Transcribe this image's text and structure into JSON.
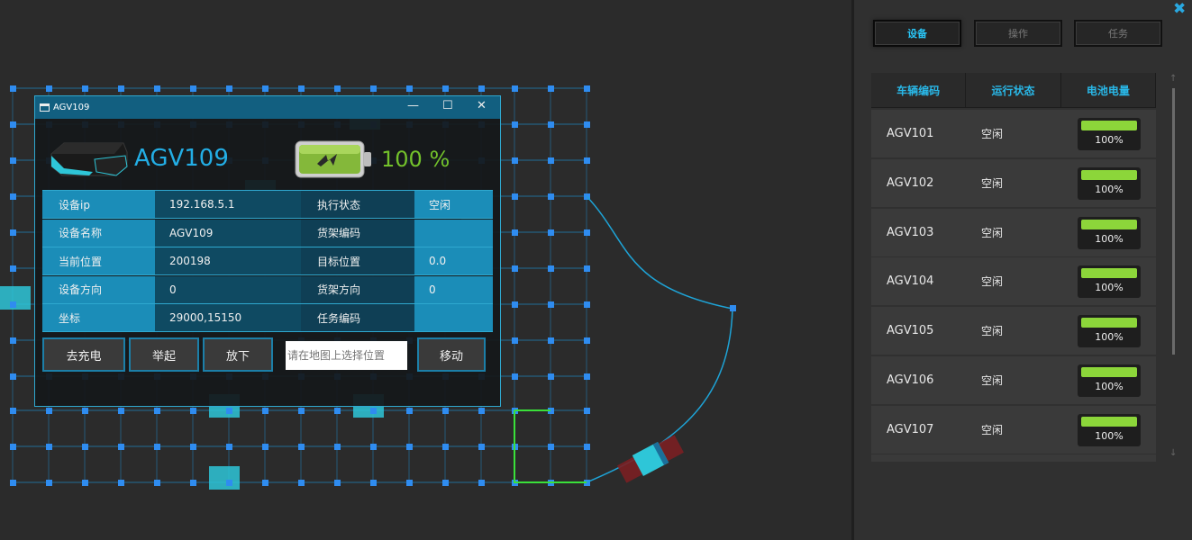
{
  "app": {
    "close_icon": "close-icon",
    "accent": "#29c5f6"
  },
  "tabs": [
    {
      "label": "设备",
      "active": true
    },
    {
      "label": "操作",
      "active": false
    },
    {
      "label": "任务",
      "active": false
    }
  ],
  "table": {
    "headers": [
      "车辆编码",
      "运行状态",
      "电池电量"
    ],
    "rows": [
      {
        "id": "AGV101",
        "status": "空闲",
        "battery": "100%",
        "level": 1.0
      },
      {
        "id": "AGV102",
        "status": "空闲",
        "battery": "100%",
        "level": 1.0
      },
      {
        "id": "AGV103",
        "status": "空闲",
        "battery": "100%",
        "level": 1.0
      },
      {
        "id": "AGV104",
        "status": "空闲",
        "battery": "100%",
        "level": 1.0
      },
      {
        "id": "AGV105",
        "status": "空闲",
        "battery": "100%",
        "level": 1.0
      },
      {
        "id": "AGV106",
        "status": "空闲",
        "battery": "100%",
        "level": 1.0
      },
      {
        "id": "AGV107",
        "status": "空闲",
        "battery": "100%",
        "level": 1.0
      }
    ]
  },
  "dialog": {
    "title": "AGV109",
    "agv_name": "AGV109",
    "battery_text": "100 %",
    "battery_level": 1.0,
    "info": [
      {
        "l1": "设备ip",
        "v1": "192.168.5.1",
        "l2": "执行状态",
        "v2": "空闲"
      },
      {
        "l1": "设备名称",
        "v1": "AGV109",
        "l2": "货架编码",
        "v2": ""
      },
      {
        "l1": "当前位置",
        "v1": "200198",
        "l2": "目标位置",
        "v2": "0.0"
      },
      {
        "l1": "设备方向",
        "v1": "0",
        "l2": "货架方向",
        "v2": "0"
      },
      {
        "l1": "坐标",
        "v1": "29000,15150",
        "l2": "任务编码",
        "v2": ""
      }
    ],
    "buttons": {
      "charge": "去充电",
      "lift": "举起",
      "drop": "放下",
      "move": "移动"
    },
    "location_placeholder": "请在地图上选择位置"
  },
  "colors": {
    "grid": "#1f88c6",
    "node": "#2f8cf0",
    "route": "#3ae03a",
    "path": "#1ea3d6",
    "agv": "#2ec6d8",
    "battery_fill": "#8cd63a"
  }
}
